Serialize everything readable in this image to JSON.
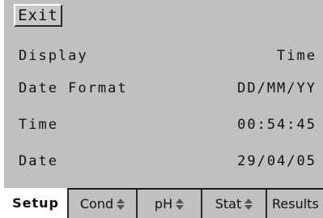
{
  "exit_label": "Exit",
  "settings": [
    {
      "label": "Display",
      "value": "Time"
    },
    {
      "label": "Date Format",
      "value": "DD/MM/YY"
    },
    {
      "label": "Time",
      "value": "00:54:45"
    },
    {
      "label": "Date",
      "value": "29/04/05"
    }
  ],
  "tabs": [
    {
      "label": "Setup",
      "active": true,
      "has_arrows": false
    },
    {
      "label": "Cond",
      "active": false,
      "has_arrows": true
    },
    {
      "label": "pH",
      "active": false,
      "has_arrows": true
    },
    {
      "label": "Stat",
      "active": false,
      "has_arrows": true
    },
    {
      "label": "Results",
      "active": false,
      "has_arrows": false
    }
  ],
  "colors": {
    "background": "#c0c0c0",
    "active_tab": "#ffffff",
    "text": "#111111"
  }
}
